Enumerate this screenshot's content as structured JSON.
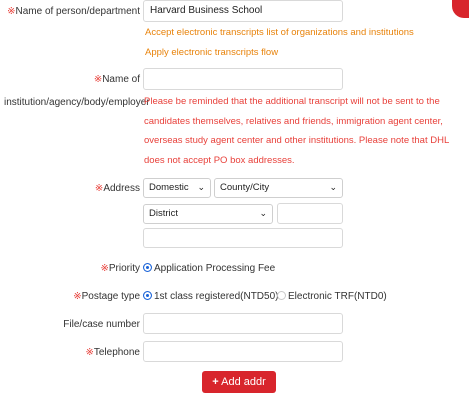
{
  "form": {
    "name_person_dept": {
      "req": "※",
      "label": "Name of person/department",
      "value": "Harvard Business School"
    },
    "links": {
      "accept_list": "Accept electronic transcripts list of organizations and institutions",
      "apply_flow": "Apply electronic transcripts flow"
    },
    "institution": {
      "req": "※",
      "label_line1": "Name of",
      "label_line2": "institution/agency/body/employer",
      "value": "",
      "notice": "Please be reminded that the additional transcript will not be sent to the candidates themselves, relatives and friends, immigration agent center, overseas study agent center and other institutions. Please note that DHL does not accept PO box addresses."
    },
    "address": {
      "req": "※",
      "label": "Address",
      "region_select": "Domestic",
      "county_select": "County/City",
      "district_select": "District",
      "postal_value": "",
      "street_value": ""
    },
    "priority": {
      "req": "※",
      "label": "Priority",
      "option": "Application Processing Fee"
    },
    "postage": {
      "req": "※",
      "label": "Postage type",
      "option1": "1st class registered(NTD50)",
      "option2": "Electronic TRF(NTD0)"
    },
    "file_case": {
      "label": "File/case number",
      "value": ""
    },
    "telephone": {
      "req": "※",
      "label": "Telephone",
      "value": ""
    },
    "add_button": {
      "icon": "+",
      "label": "Add addr"
    }
  },
  "colors": {
    "required": "#e8413b",
    "link": "#e8830b",
    "button": "#d8252c",
    "radio": "#1a63d8"
  }
}
